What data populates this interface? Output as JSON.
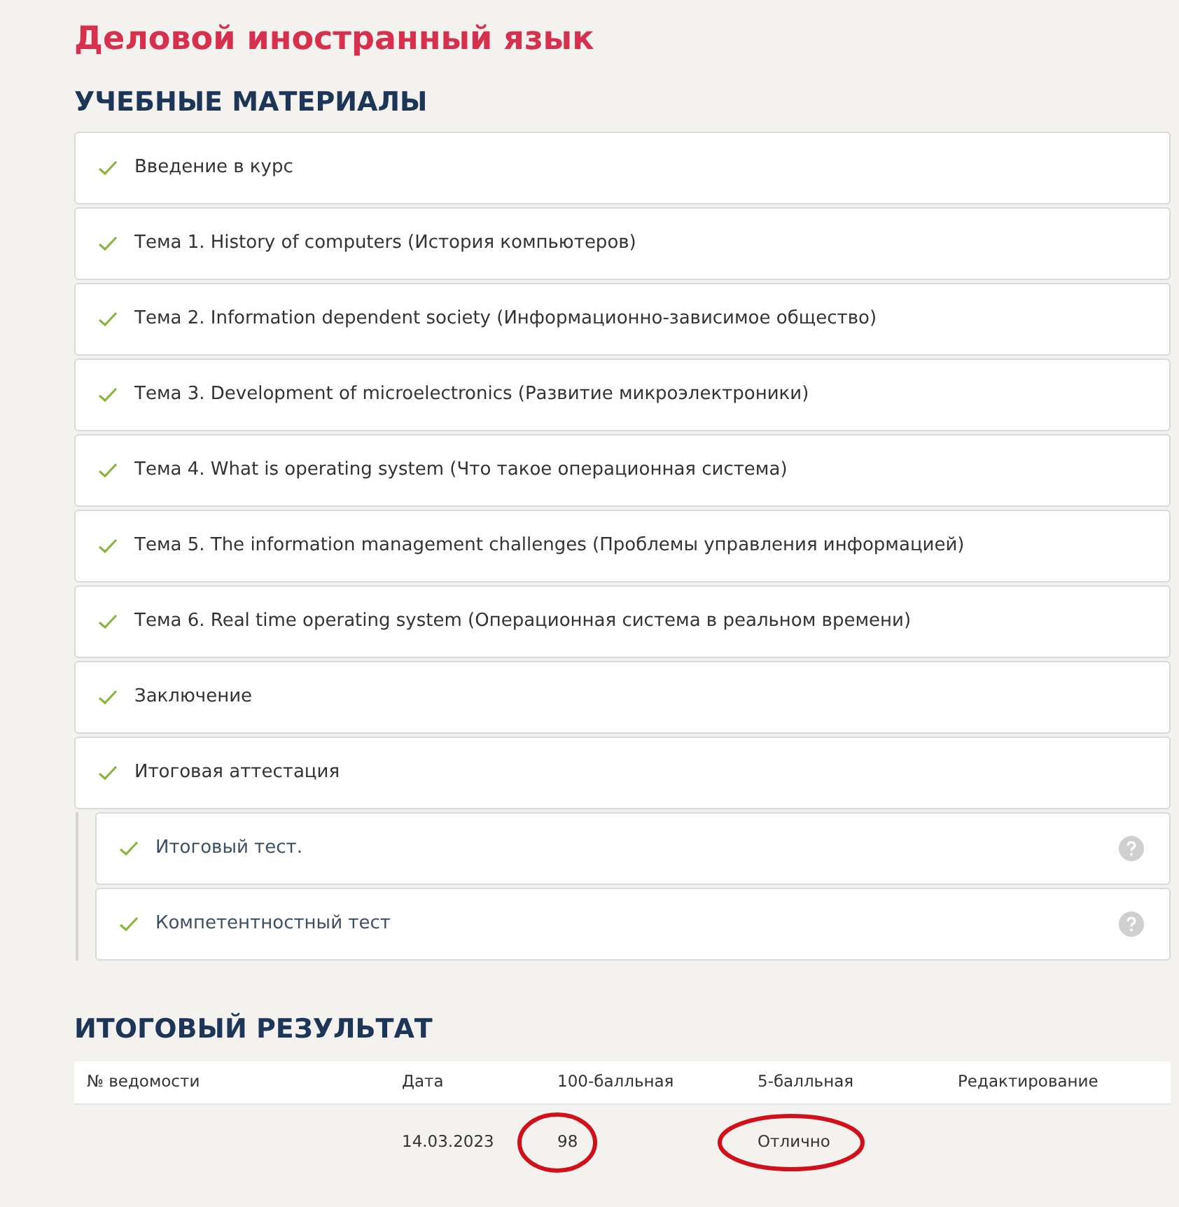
{
  "course_title": "Деловой иностранный язык",
  "materials": {
    "heading": "УЧЕБНЫЕ МАТЕРИАЛЫ",
    "items": [
      {
        "title": "Введение в курс",
        "checked": true
      },
      {
        "title": "Тема 1. History of computers (История компьютеров)",
        "checked": true
      },
      {
        "title": "Тема 2. Information dependent society (Информационно-зависимое общество)",
        "checked": true
      },
      {
        "title": "Тема 3. Development of microelectronics (Развитие микроэлектроники)",
        "checked": true
      },
      {
        "title": "Тема 4. What is operating system (Что такое операционная система)",
        "checked": true
      },
      {
        "title": "Тема 5. The information management challenges (Проблемы управления информацией)",
        "checked": true
      },
      {
        "title": "Тема 6. Real time operating system (Операционная система в реальном времени)",
        "checked": true
      },
      {
        "title": "Заключение",
        "checked": true
      },
      {
        "title": "Итоговая аттестация",
        "checked": true,
        "children": [
          {
            "title": "Итоговый тест.",
            "checked": true
          },
          {
            "title": "Компетентностный тест",
            "checked": true
          }
        ]
      }
    ]
  },
  "result": {
    "heading": "ИТОГОВЫЙ РЕЗУЛЬТАТ",
    "columns": [
      "№ ведомости",
      "Дата",
      "100-балльная",
      "5-балльная",
      "Редактирование"
    ],
    "rows": [
      {
        "cells": [
          {
            "text": ""
          },
          {
            "text": "14.03.2023",
            "circled": false
          },
          {
            "text": "98",
            "circled": true
          },
          {
            "text": "Отлично",
            "circled": true
          },
          {
            "text": ""
          }
        ]
      }
    ]
  }
}
